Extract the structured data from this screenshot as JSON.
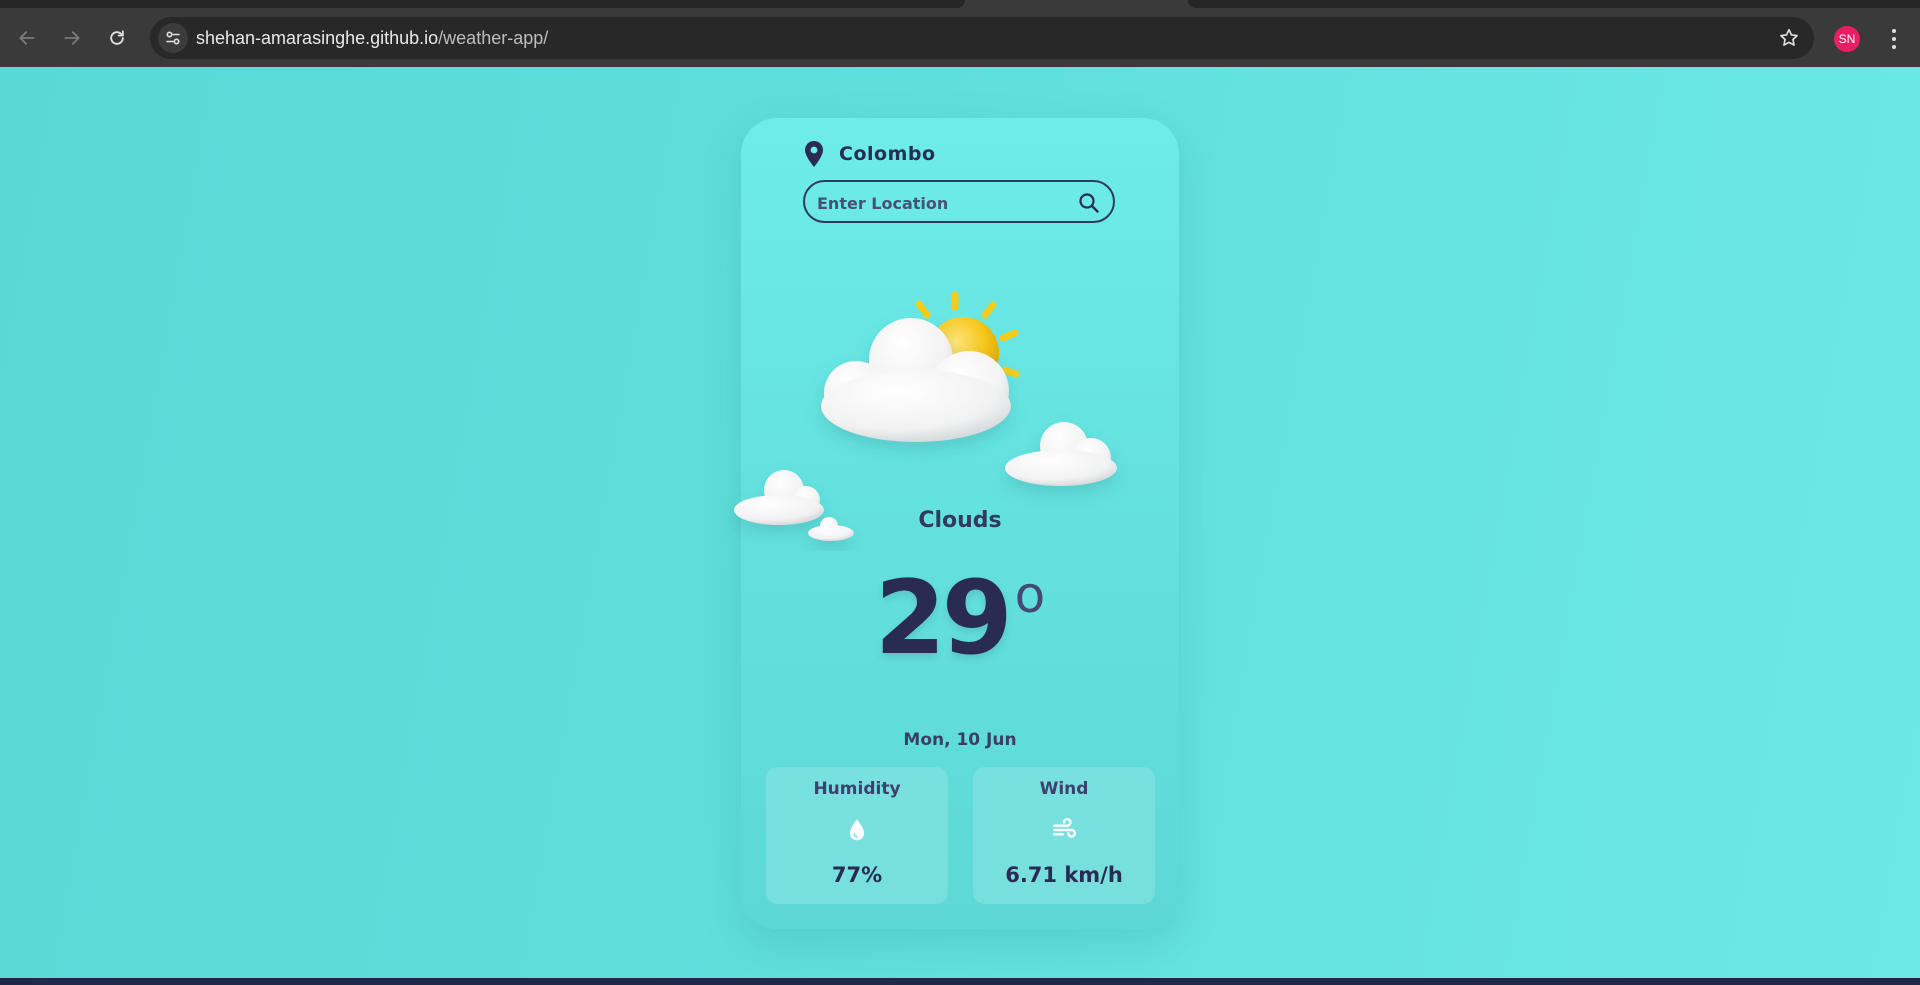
{
  "browser": {
    "url_host": "shehan-amarasinghe.github.io",
    "url_path": "/weather-app/",
    "profile_initials": "SN"
  },
  "weather": {
    "location": "Colombo",
    "search_placeholder": "Enter Location",
    "condition": "Clouds",
    "temperature": "29",
    "temperature_unit": "o",
    "date": "Mon, 10 Jun",
    "humidity": {
      "label": "Humidity",
      "value": "77%",
      "icon": "water-drop-icon"
    },
    "wind": {
      "label": "Wind",
      "value": "6.71 km/h",
      "icon": "wind-icon"
    }
  },
  "colors": {
    "background": "#5fdfdc",
    "card": "#6decea",
    "text_dark": "#2a2b52",
    "avatar": "#e91e63"
  }
}
